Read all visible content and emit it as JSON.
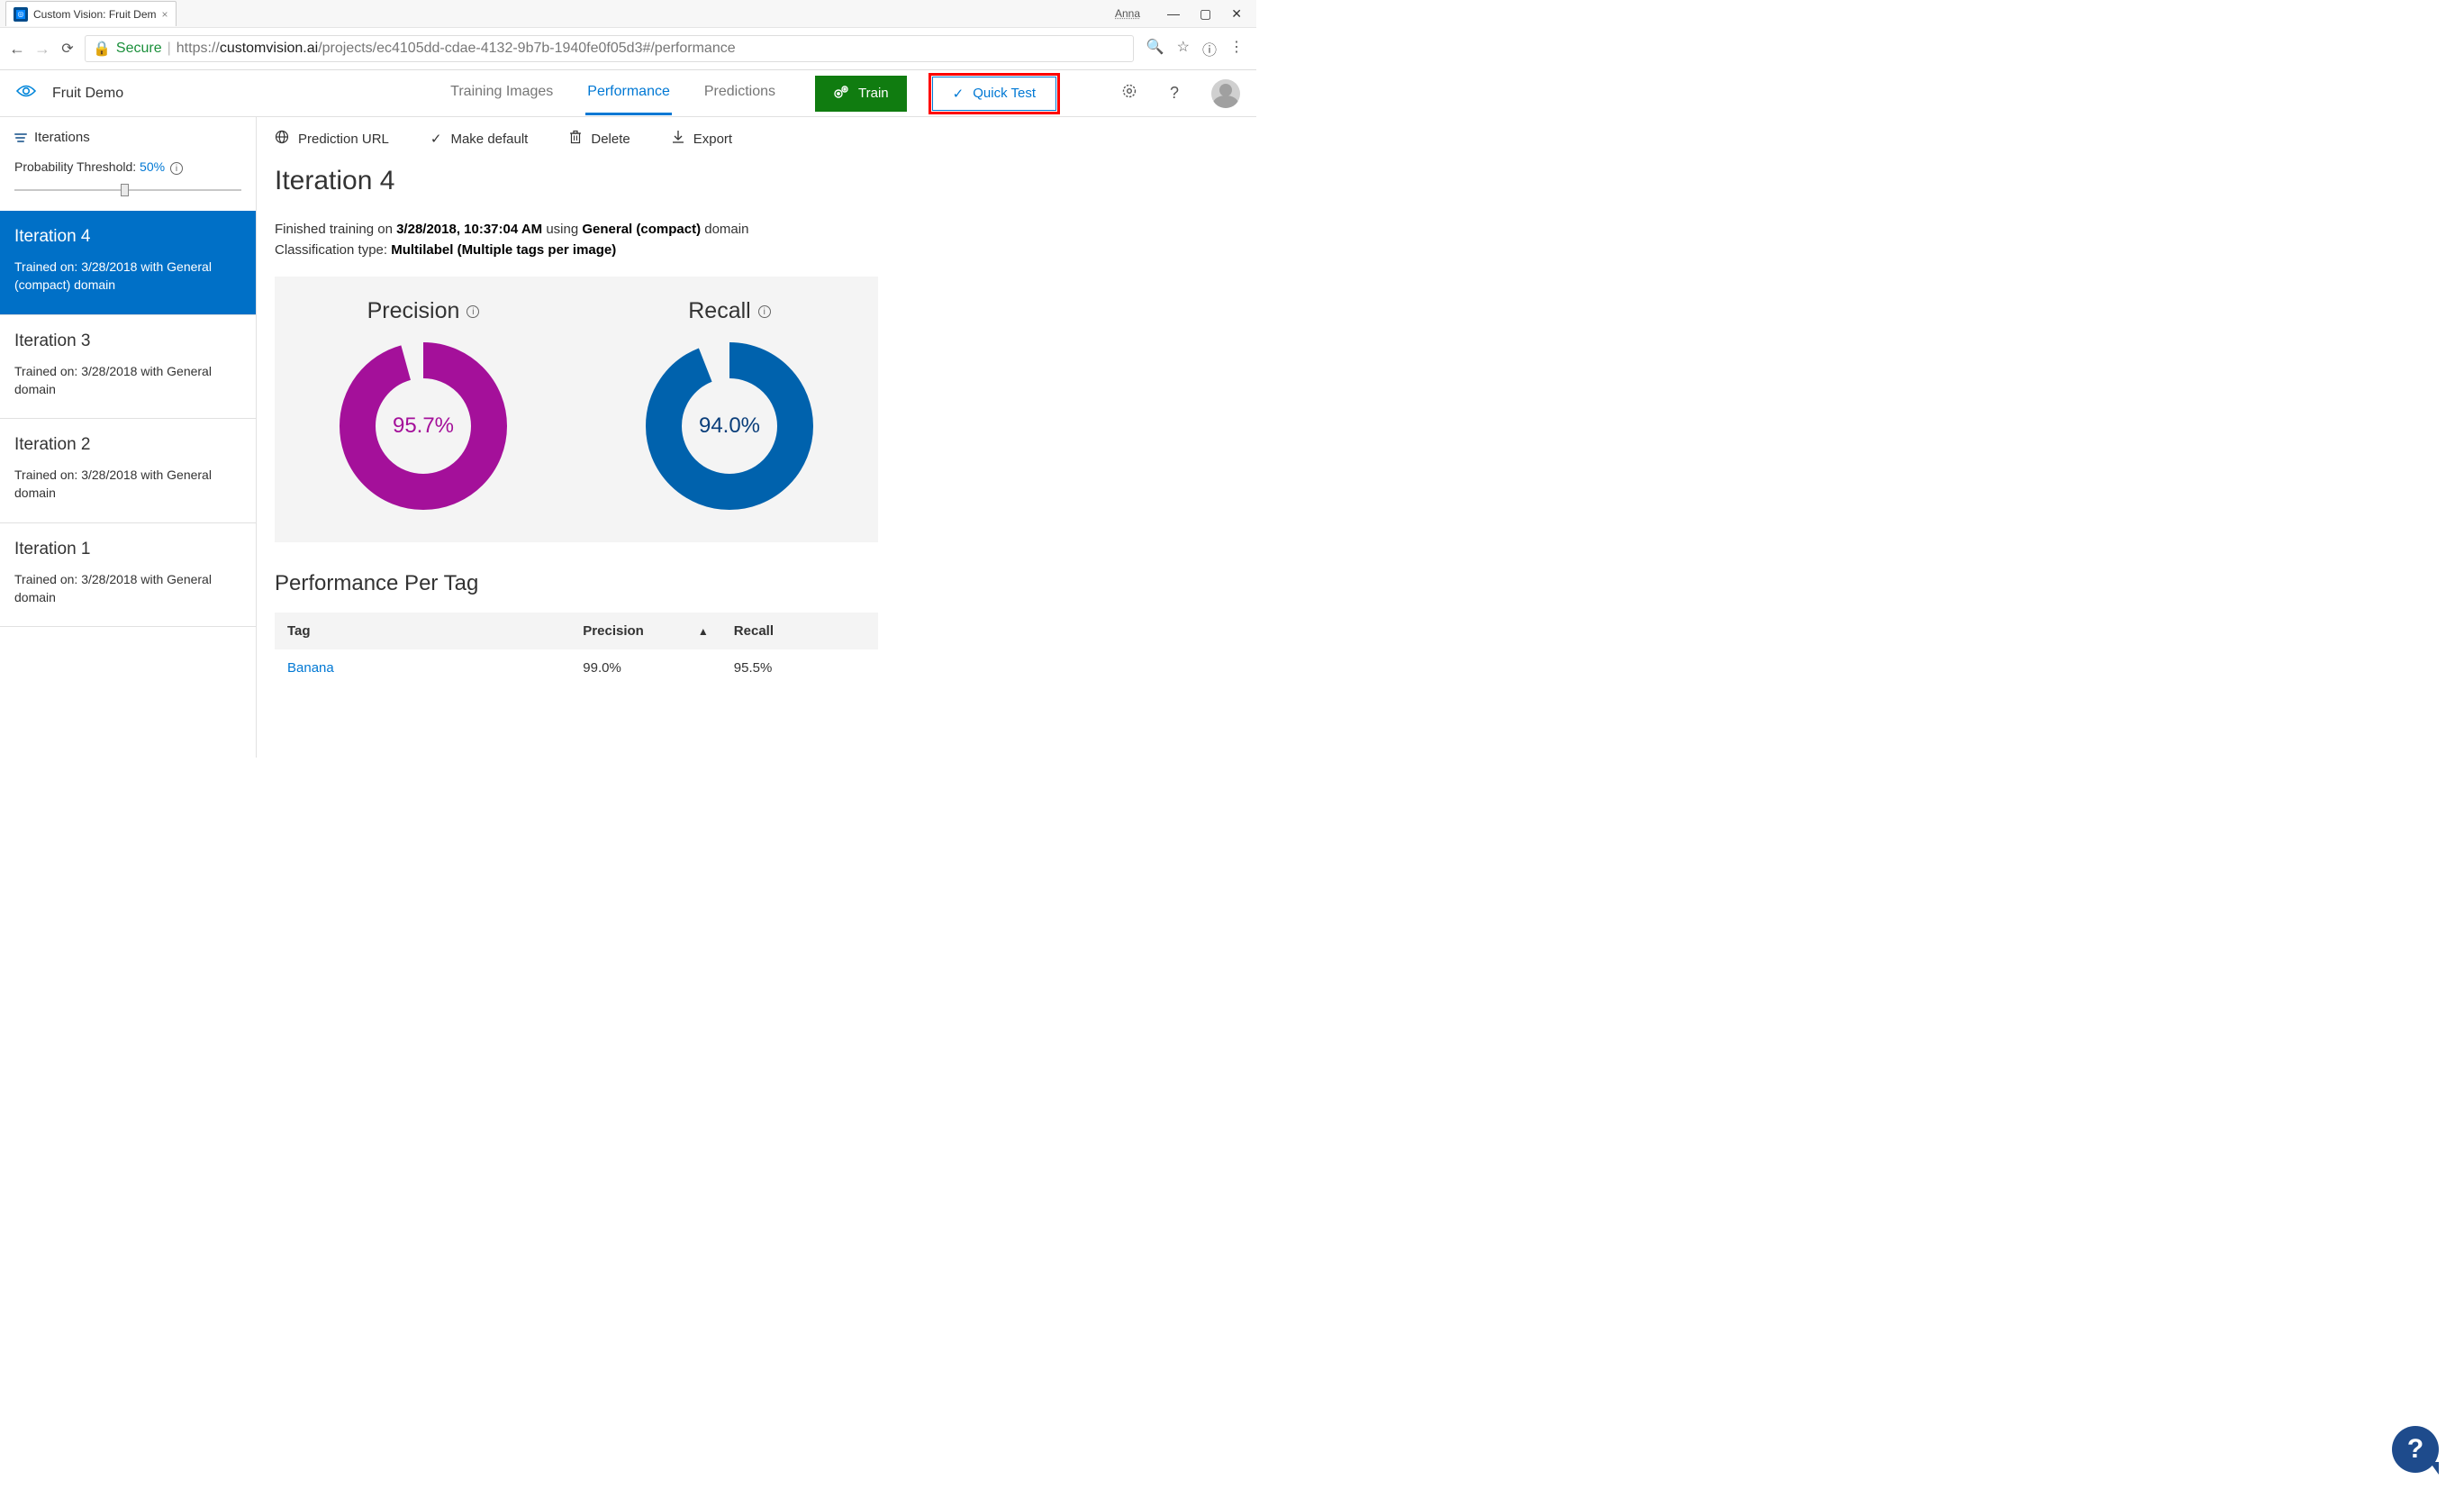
{
  "browser": {
    "tab_title": "Custom Vision: Fruit Dem",
    "user_name": "Anna",
    "secure_label": "Secure",
    "url_prefix": "https://",
    "url_host": "customvision.ai",
    "url_path": "/projects/ec4105dd-cdae-4132-9b7b-1940fe0f05d3#/performance"
  },
  "header": {
    "project_name": "Fruit Demo",
    "nav": {
      "training_images": "Training Images",
      "performance": "Performance",
      "predictions": "Predictions"
    },
    "train_label": "Train",
    "quick_test_label": "Quick Test"
  },
  "sidebar": {
    "iterations_label": "Iterations",
    "threshold_label": "Probability Threshold:",
    "threshold_value": "50%",
    "items": [
      {
        "title": "Iteration 4",
        "sub": "Trained on: 3/28/2018 with General (compact) domain",
        "selected": true
      },
      {
        "title": "Iteration 3",
        "sub": "Trained on: 3/28/2018 with General domain",
        "selected": false
      },
      {
        "title": "Iteration 2",
        "sub": "Trained on: 3/28/2018 with General domain",
        "selected": false
      },
      {
        "title": "Iteration 1",
        "sub": "Trained on: 3/28/2018 with General domain",
        "selected": false
      }
    ]
  },
  "toolbar": {
    "prediction_url": "Prediction URL",
    "make_default": "Make default",
    "delete": "Delete",
    "export": "Export"
  },
  "page": {
    "title": "Iteration 4",
    "meta_prefix": "Finished training on ",
    "meta_datetime": "3/28/2018, 10:37:04 AM",
    "meta_using": " using ",
    "meta_domain": "General (compact)",
    "meta_domain_suffix": " domain",
    "meta_class_prefix": "Classification type: ",
    "meta_class_type": "Multilabel (Multiple tags per image)",
    "precision_label": "Precision",
    "recall_label": "Recall",
    "precision_value_text": "95.7%",
    "recall_value_text": "94.0%",
    "section_title": "Performance Per Tag",
    "table": {
      "h_tag": "Tag",
      "h_precision": "Precision",
      "h_recall": "Recall",
      "row_tag": "Banana",
      "row_precision": "99.0%",
      "row_recall": "95.5%"
    }
  },
  "chart_data": [
    {
      "type": "pie",
      "title": "Precision",
      "series": [
        {
          "name": "Precision",
          "values": [
            95.7
          ],
          "color": "#a4109a"
        }
      ],
      "ylim": [
        0,
        100
      ],
      "remaining": 4.3
    },
    {
      "type": "pie",
      "title": "Recall",
      "series": [
        {
          "name": "Recall",
          "values": [
            94.0
          ],
          "color": "#0062ad"
        }
      ],
      "ylim": [
        0,
        100
      ],
      "remaining": 6.0
    }
  ],
  "colors": {
    "azure_blue": "#0078d4",
    "train_green": "#107c10",
    "precision": "#a4109a",
    "recall": "#0062ad",
    "highlight_red": "#ff0000"
  },
  "help_glyph": "?"
}
